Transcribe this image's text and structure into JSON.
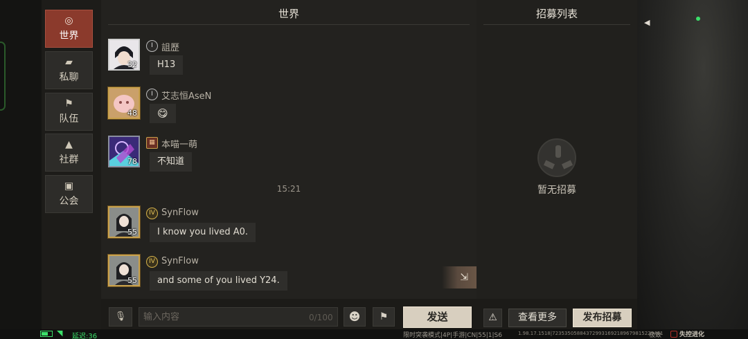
{
  "nav": {
    "items": [
      {
        "label": "世界",
        "icon": "compass-icon",
        "active": true
      },
      {
        "label": "私聊",
        "icon": "chat-bubbles-icon",
        "active": false
      },
      {
        "label": "队伍",
        "icon": "flag-icon",
        "active": false
      },
      {
        "label": "社群",
        "icon": "campfire-icon",
        "active": false
      },
      {
        "label": "公会",
        "icon": "banner-icon",
        "active": false
      }
    ]
  },
  "chat": {
    "title": "世界",
    "timestamp": "15:21",
    "messages": [
      {
        "username": "詛歷",
        "level": "32",
        "text": "H13",
        "rank": "I"
      },
      {
        "username": "艾志恒AseN",
        "level": "48",
        "text": "😋",
        "rank": "I"
      },
      {
        "username": "本喵一萌",
        "level": "78",
        "text": "不知道",
        "rank": ""
      },
      {
        "username": "SynFlow",
        "level": "55",
        "text": "I know you lived A0.",
        "rank": "IV"
      },
      {
        "username": "SynFlow",
        "level": "55",
        "text": "and some of you lived Y24.",
        "rank": "IV"
      }
    ],
    "input_placeholder": "输入内容",
    "char_count": "0/100",
    "send_label": "发送"
  },
  "recruit": {
    "title": "招募列表",
    "empty_text": "暂无招募",
    "view_more_label": "查看更多",
    "publish_label": "发布招募"
  },
  "status": {
    "latency": "延迟:36",
    "build_info": "限时突袭模式|4P|手游|CN|55|1|S6",
    "build_hash": "1.98.17.1518|723535058843729931692189679815229461",
    "quality": "极致",
    "logo_text": "失控进化"
  },
  "colors": {
    "active_tab": "#8b3a2c",
    "send_button": "#d8cfbf",
    "status_green": "#3be06a"
  }
}
